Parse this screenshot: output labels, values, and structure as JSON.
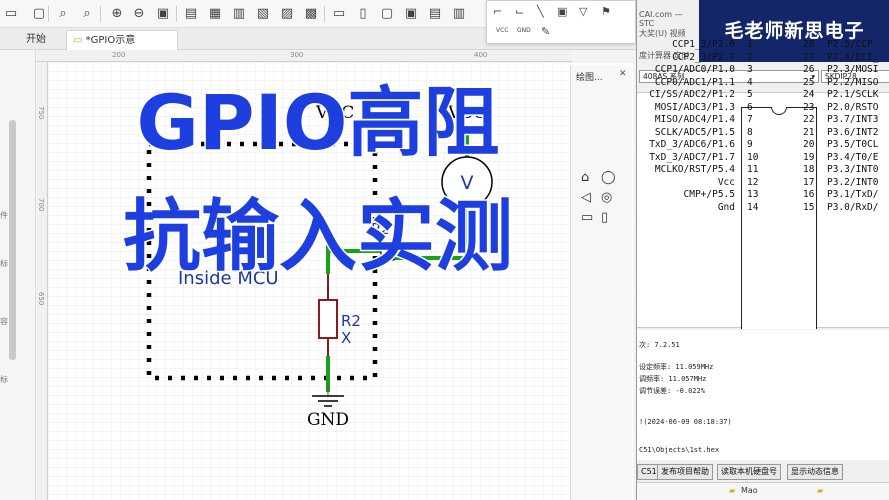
{
  "tabs": [
    {
      "label": "开始"
    },
    {
      "label": "*GPIO示意"
    }
  ],
  "shapes_panel": {
    "title": "绘图..."
  },
  "popup": {
    "labels": [
      "VCC",
      "GND"
    ]
  },
  "circuit": {
    "vcc_left": "VCC",
    "vcc_right": "VCC",
    "voltmeter": "V",
    "port_label": "P2",
    "port_pin": "1",
    "inside_label": "Inside MCU",
    "resistor_name": "R2",
    "resistor_value": "X",
    "gnd": "GND"
  },
  "ruler": {
    "top": [
      "200",
      "300",
      "400"
    ],
    "left": [
      "750",
      "700",
      "650"
    ]
  },
  "gutter": [
    "件",
    "标",
    "容",
    "标"
  ],
  "overlay": {
    "line1": "GPIO高阻",
    "line2": "抗输入实测"
  },
  "stc": {
    "url_fragment": "CAI.com — STC",
    "menu": "大奖(U)   视频",
    "calc": "度计算器   定时",
    "model": "408AS 系列",
    "package": "SKDIP28",
    "banner": "毛老师新思电子",
    "left_pins": [
      "CCP1_3/P2.6",
      "CCP2_3/P2.7",
      "CCP1/ADC0/P1.0",
      "CCP0/ADC1/P1.1",
      "CI/SS/ADC2/P1.2",
      "MOSI/ADC3/P1.3",
      "MISO/ADC4/P1.4",
      "SCLK/ADC5/P1.5",
      "TxD_3/ADC6/P1.6",
      "TxD_3/ADC7/P1.7",
      "MCLKO/RST/P5.4",
      "Vcc",
      "CMP+/P5.5",
      "Gnd"
    ],
    "left_nums": [
      "1",
      "2",
      "3",
      "4",
      "5",
      "6",
      "7",
      "8",
      "9",
      "10",
      "11",
      "12",
      "13",
      "14"
    ],
    "right_nums": [
      "28",
      "27",
      "26",
      "25",
      "24",
      "23",
      "22",
      "21",
      "20",
      "19",
      "18",
      "17",
      "16",
      "15"
    ],
    "right_pins": [
      "P2.5/CCP",
      "P2.4/ECI_",
      "P2.3/MOSI",
      "P2.2/MISO",
      "P2.1/SCLK",
      "P2.0/RSTO",
      "P3.7/INT3",
      "P3.6/INT2",
      "P3.5/T0CL",
      "P3.4/T0/E",
      "P3.3/INT0",
      "P3.2/INT0",
      "P3.1/TxD/",
      "P3.0/RxD/"
    ],
    "log": [
      "次: 7.2.51",
      "设定频率:  11.059MHz",
      "调频率:  11.057MHz",
      "调节误差:  -0.022%",
      "",
      "!(2024-06-09 08:18:37)",
      "",
      "C51\\Objects\\1st.hex"
    ],
    "buttons": [
      "C51",
      "发布项目帮助",
      "读取本机硬盘号",
      "显示动态信息"
    ],
    "taskbar": "Mao"
  }
}
